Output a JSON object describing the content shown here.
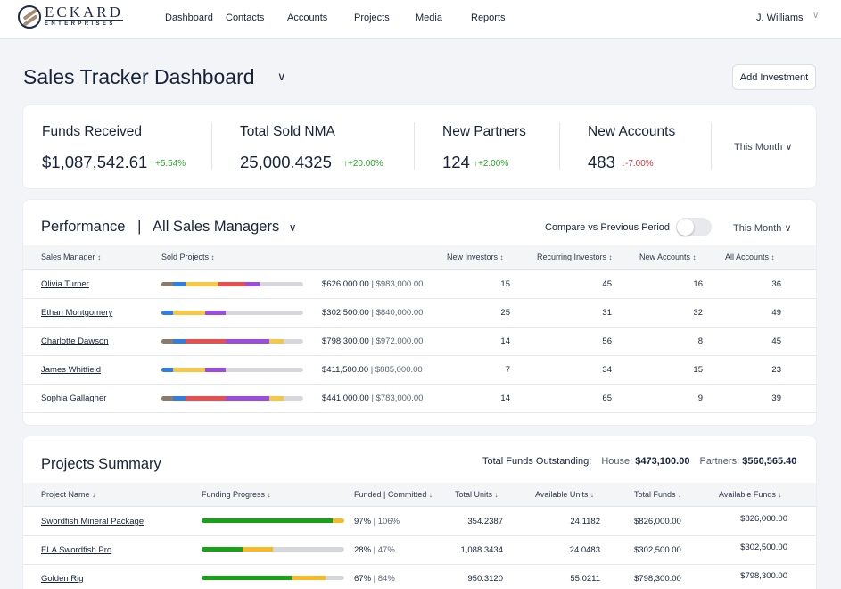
{
  "brand": {
    "name": "ECKARD",
    "sub": "ENTERPRISES",
    "logo_icon": "eckard-logo-icon"
  },
  "nav": {
    "items": [
      {
        "label": "Dashboard"
      },
      {
        "label": "Contacts"
      },
      {
        "label": "Accounts"
      },
      {
        "label": "Projects"
      },
      {
        "label": "Media"
      },
      {
        "label": "Reports"
      }
    ],
    "user": "J. Williams",
    "user_chevron": "∨"
  },
  "header": {
    "title": "Sales Tracker Dashboard",
    "title_chevron": "∨",
    "add_button": "Add Investment"
  },
  "stats": {
    "items": [
      {
        "label": "Funds Received",
        "value": "$1,087,542.61",
        "delta": "↑+5.54%",
        "direction": "up"
      },
      {
        "label": "Total Sold NMA",
        "value": "25,000.4325",
        "delta": "↑+20.00%",
        "direction": "up"
      },
      {
        "label": "New Partners",
        "value": "124",
        "delta": "↑+2.00%",
        "direction": "up"
      },
      {
        "label": "New Accounts",
        "value": "483",
        "delta": "↓-7.00%",
        "direction": "down"
      }
    ],
    "period": "This Month ∨"
  },
  "colors": {
    "up": "#2aa62a",
    "down": "#e0323a",
    "segments": {
      "brown": "#8c7b6b",
      "blue": "#2f7ee6",
      "yellow": "#f6c744",
      "red": "#ea4f4f",
      "purple": "#9b4de0",
      "track": "#d6d7da"
    },
    "funded": "#1aa11a",
    "committed": "#f8b929"
  },
  "performance": {
    "title": "Performance",
    "separator": "|",
    "filter": "All Sales Managers",
    "filter_chevron": "∨",
    "compare_label": "Compare vs Previous Period",
    "compare_enabled": false,
    "period": "This Month ∨",
    "columns": [
      "Sales Manager",
      "Sold Projects",
      "New Investors",
      "Recurring Investors",
      "New Accounts",
      "All Accounts"
    ],
    "sort_icon": "↕",
    "rows": [
      {
        "name": "Olivia Turner",
        "sold": "$626,000.00",
        "total": "$983,000.00",
        "segments": [
          [
            "brown",
            8
          ],
          [
            "blue",
            9
          ],
          [
            "yellow",
            23
          ],
          [
            "red",
            19
          ],
          [
            "purple",
            10
          ]
        ],
        "new_investors": "15",
        "recurring_investors": "45",
        "new_accounts": "16",
        "all_accounts": "36"
      },
      {
        "name": "Ethan Montgomery",
        "sold": "$302,500.00",
        "total": "$840,000.00",
        "segments": [
          [
            "blue",
            8
          ],
          [
            "yellow",
            23
          ],
          [
            "purple",
            14
          ]
        ],
        "new_investors": "25",
        "recurring_investors": "31",
        "new_accounts": "32",
        "all_accounts": "49"
      },
      {
        "name": "Charlotte Dawson",
        "sold": "$798,300.00",
        "total": "$972,000.00",
        "segments": [
          [
            "brown",
            8
          ],
          [
            "blue",
            9
          ],
          [
            "red",
            28
          ],
          [
            "purple",
            31
          ],
          [
            "yellow",
            10
          ]
        ],
        "new_investors": "14",
        "recurring_investors": "56",
        "new_accounts": "8",
        "all_accounts": "45"
      },
      {
        "name": "James Whitfield",
        "sold": "$411,500.00",
        "total": "$885,000.00",
        "segments": [
          [
            "blue",
            8
          ],
          [
            "yellow",
            23
          ],
          [
            "purple",
            14
          ]
        ],
        "new_investors": "7",
        "recurring_investors": "34",
        "new_accounts": "15",
        "all_accounts": "23"
      },
      {
        "name": "Sophia Gallagher",
        "sold": "$441,000.00",
        "total": "$783,000.00",
        "segments": [
          [
            "brown",
            8
          ],
          [
            "blue",
            9
          ],
          [
            "red",
            28
          ],
          [
            "purple",
            31
          ],
          [
            "yellow",
            10
          ]
        ],
        "new_investors": "14",
        "recurring_investors": "65",
        "new_accounts": "9",
        "all_accounts": "39"
      }
    ]
  },
  "projects": {
    "title": "Projects Summary",
    "outstanding_label": "Total Funds Outstanding:",
    "house_label": "House:",
    "house_value": "$473,100.00",
    "partners_label": "Partners:",
    "partners_value": "$560,565.40",
    "columns": [
      "Project Name",
      "Funding Progress",
      "Funded | Committed",
      "Total Units",
      "Available Units",
      "Total Funds",
      "Available Funds"
    ],
    "rows": [
      {
        "name": "Swordfish Mineral Package",
        "funded_pct": 92,
        "committed_pct": 100,
        "funded_label": "97%",
        "committed_label": "106%",
        "total_units": "354.2387",
        "available_units": "24.1182",
        "total_funds": "$826,000.00",
        "available_funds": "$826,000.00"
      },
      {
        "name": "ELA Swordfish Pro",
        "funded_pct": 29,
        "committed_pct": 50,
        "funded_label": "28%",
        "committed_label": "47%",
        "total_units": "1,088.3434",
        "available_units": "24.0483",
        "total_funds": "$302,500.00",
        "available_funds": "$302,500.00"
      },
      {
        "name": "Golden Rig",
        "funded_pct": 63,
        "committed_pct": 87,
        "funded_label": "67%",
        "committed_label": "84%",
        "total_units": "950.3120",
        "available_units": "55.0211",
        "total_funds": "$798,300.00",
        "available_funds": "$798,300.00"
      }
    ]
  }
}
